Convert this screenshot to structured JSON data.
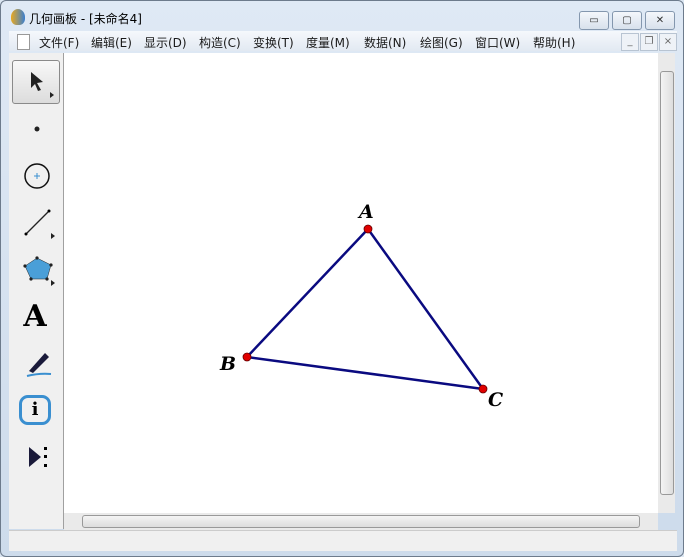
{
  "window": {
    "title": "几何画板 - [未命名4]",
    "minimize": "▭",
    "maximize": "▢",
    "close": "✕"
  },
  "menu": [
    {
      "label": "文件(F)"
    },
    {
      "label": "编辑(E)"
    },
    {
      "label": "显示(D)"
    },
    {
      "label": "构造(C)"
    },
    {
      "label": "变换(T)"
    },
    {
      "label": "度量(M)"
    },
    {
      "label": "数据(N)"
    },
    {
      "label": "绘图(G)"
    },
    {
      "label": "窗口(W)"
    },
    {
      "label": "帮助(H)"
    }
  ],
  "mdi": {
    "minimize": "_",
    "restore": "❐",
    "close": "×"
  },
  "tools": [
    "arrow-select",
    "point",
    "compass",
    "straightedge",
    "polygon",
    "text",
    "marker",
    "information",
    "custom-tools"
  ],
  "text_tool_glyph": "A",
  "info_glyph": "i",
  "points": [
    {
      "label": "A"
    },
    {
      "label": "B"
    },
    {
      "label": "C"
    }
  ],
  "colors": {
    "segment": "#0a0a80",
    "point": "#e00000"
  }
}
